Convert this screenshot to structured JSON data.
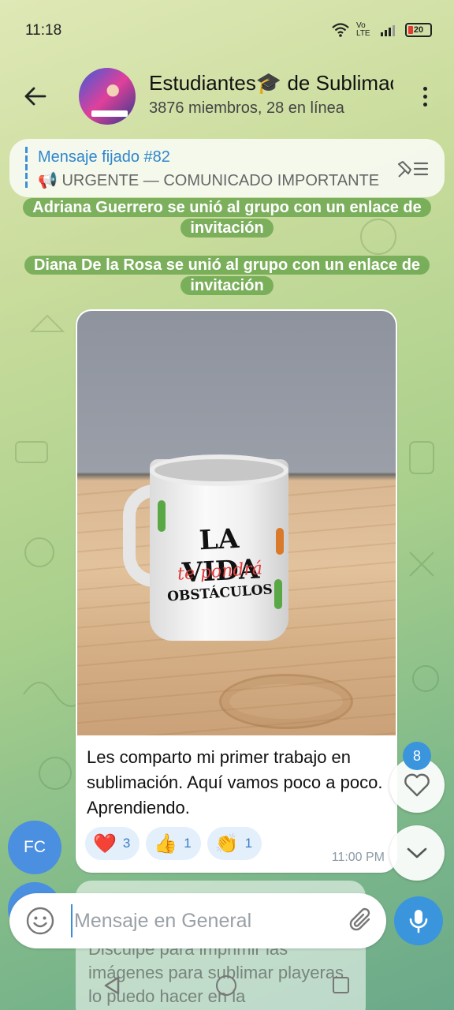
{
  "status_bar": {
    "time": "11:18",
    "network": "Vo LTE",
    "battery": "20"
  },
  "header": {
    "title": "Estudiantes🎓 de Sublimación",
    "subtitle": "3876 miembros, 28 en línea"
  },
  "pinned": {
    "title": "Mensaje fijado #82",
    "text": "📢 URGENTE — COMUNICADO IMPORTANTE"
  },
  "service_messages": [
    "Adriana Guerrero se unió al grupo con un enlace de invitación",
    "Diana De la Rosa se unió al grupo con un enlace de invitación"
  ],
  "message": {
    "photo": {
      "line1": "LA VIDA",
      "line2": "te pondrá",
      "line3": "OBSTÁCULOS"
    },
    "text": "Les comparto mi primer trabajo en sublimación. Aquí vamos poco a poco. Aprendiendo.",
    "reactions": [
      {
        "emoji": "❤️",
        "count": "3"
      },
      {
        "emoji": "👍",
        "count": "1"
      },
      {
        "emoji": "👏",
        "count": "1"
      }
    ],
    "time": "11:00 PM",
    "sender_initials": "FC"
  },
  "like_count": "8",
  "next_message": {
    "text": "Disculpe para imprimir las imágenes para sublimar playeras lo puedo hacer en la"
  },
  "input": {
    "placeholder": "Mensaje en General"
  },
  "colors": {
    "accent": "#3a95dc",
    "service_bg": "#62a046",
    "bubble": "#ffffff"
  },
  "icons": [
    "back-arrow-icon",
    "more-vert-icon",
    "unpin-list-icon",
    "heart-outline-icon",
    "chevron-down-icon",
    "emoji-icon",
    "paperclip-icon",
    "microphone-icon"
  ]
}
